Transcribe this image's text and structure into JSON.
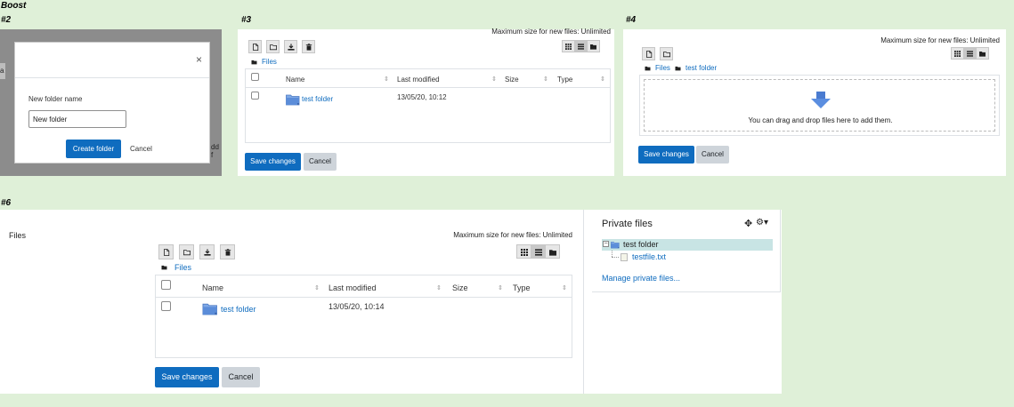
{
  "labels": {
    "theme": "Boost",
    "p2": "#2",
    "p3": "#3",
    "p4": "#4",
    "p6": "#6"
  },
  "dialog": {
    "close_glyph": "×",
    "field_label": "New folder name",
    "field_value": "New folder",
    "create_label": "Create folder",
    "cancel_label": "Cancel",
    "bg_text_left": "a",
    "bg_text_right": "dd f"
  },
  "p3": {
    "max_size": "Maximum size for new files: Unlimited",
    "breadcrumb": "Files",
    "columns": [
      "Name",
      "Last modified",
      "Size",
      "Type"
    ],
    "rows": [
      {
        "name": "test folder",
        "modified": "13/05/20, 10:12"
      }
    ],
    "save_label": "Save changes",
    "cancel_label": "Cancel"
  },
  "p4": {
    "max_size": "Maximum size for new files: Unlimited",
    "crumb1": "Files",
    "crumb2": "test folder",
    "drop_text": "You can drag and drop files here to add them.",
    "save_label": "Save changes",
    "cancel_label": "Cancel"
  },
  "p6": {
    "page_label": "Files",
    "max_size": "Maximum size for new files: Unlimited",
    "breadcrumb": "Files",
    "columns": [
      "Name",
      "Last modified",
      "Size",
      "Type"
    ],
    "rows": [
      {
        "name": "test folder",
        "modified": "13/05/20, 10:14"
      }
    ],
    "save_label": "Save changes",
    "cancel_label": "Cancel"
  },
  "private_files": {
    "title": "Private files",
    "folder": "test folder",
    "file": "testfile.txt",
    "manage_link": "Manage private files..."
  },
  "colors": {
    "background": "#dff0d8",
    "primary": "#0f6cbf",
    "secondary": "#ced4da",
    "link": "#0f6cbf",
    "tree_highlight": "#c8e4e4"
  }
}
